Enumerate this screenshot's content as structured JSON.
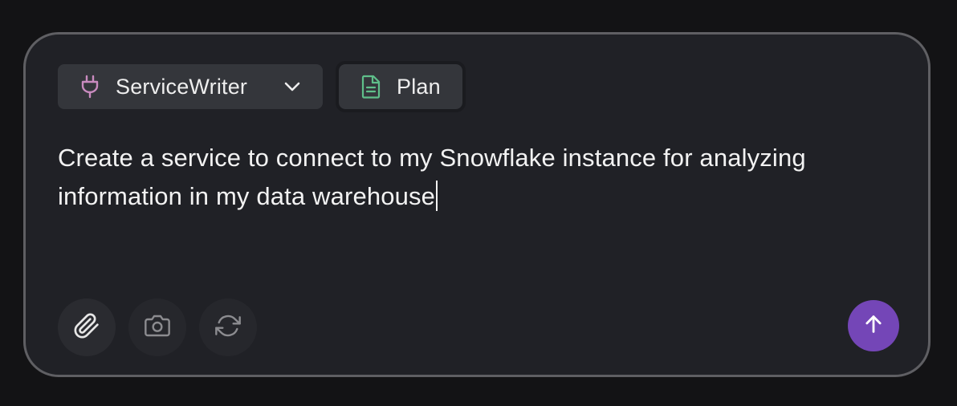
{
  "agent_selector": {
    "label": "ServiceWriter",
    "icon": "plug-icon",
    "icon_color": "#c98bbf"
  },
  "mode_button": {
    "label": "Plan",
    "icon": "document-icon",
    "icon_color": "#5fbf8a"
  },
  "prompt": {
    "text": "Create a service to connect to my Snowflake instance for analyzing information in my data warehouse"
  },
  "toolbar": {
    "attach_icon": "paperclip-icon",
    "camera_icon": "camera-icon",
    "refresh_icon": "refresh-icon"
  },
  "send_button": {
    "icon": "arrow-up-icon",
    "color": "#7446b7"
  }
}
